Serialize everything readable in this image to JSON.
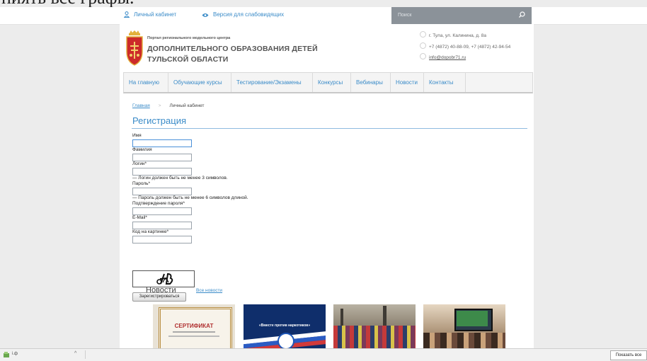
{
  "top_text": "ниять все графы.",
  "topbar": {
    "cabinet_label": "Личный кабинет",
    "low_vision_label": "Версия для слабовидящих",
    "search_placeholder": "Поиск"
  },
  "logo": {
    "subtitle": "Портал регионального модельного центра",
    "line1": "ДОПОЛНИТЕЛЬНОГО ОБРАЗОВАНИЯ ДЕТЕЙ",
    "line2": "ТУЛЬСКОЙ ОБЛАСТИ"
  },
  "contacts": {
    "address": "г. Тула, ул. Калинина, д. 8а",
    "phone": "+7 (4872) 40-88-09, +7 (4872) 42-94-54",
    "email": "info@dopobr71.ru"
  },
  "nav": [
    "На главную",
    "Обучающие курсы",
    "Тестирование/Экзамены",
    "Конкурсы",
    "Вебинары",
    "Новости",
    "Контакты"
  ],
  "breadcrumb": {
    "home": "Главная",
    "current": "Личный кабинет"
  },
  "heading": "Регистрация",
  "form": {
    "name_label": "Имя",
    "surname_label": "Фамилия",
    "login_label": "Логин*",
    "login_hint": "— Логин должен быть не менее 3 символов.",
    "password_label": "Пароль*",
    "password_hint": "— Пароль должен быть не менее 6 символов длиной.",
    "confirm_label": "Подтверждение пароля*",
    "email_label": "E-Mail*",
    "captcha_label": "Код на картинке*",
    "submit_label": "Зарегистрироваться"
  },
  "news": {
    "title": "Новости",
    "all_link": "Все новости",
    "thumb1_text": "СЕРТИФИКАТ",
    "thumb2_text": "«Вместе против наркотиков»"
  },
  "download_bar": {
    "file_label": "i.ф",
    "show_all_label": "Показать все"
  },
  "colors": {
    "accent": "#3a8bc8",
    "search_bg": "#8b9299",
    "page_bg": "#ececec"
  }
}
